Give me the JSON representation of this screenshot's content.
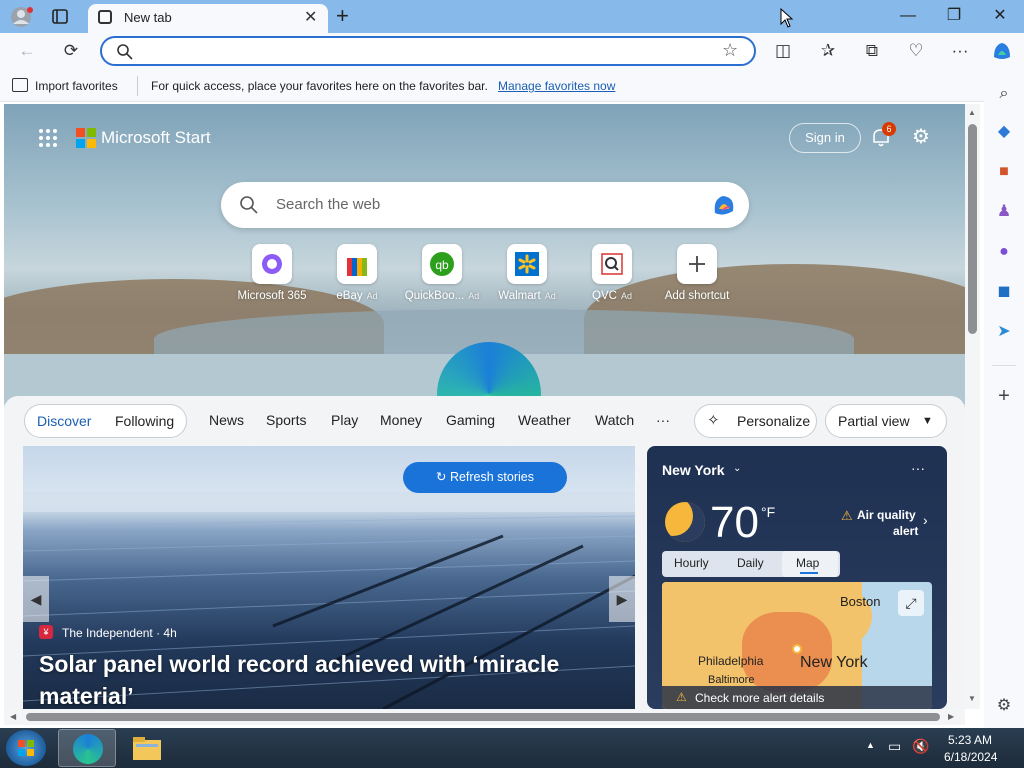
{
  "browser": {
    "tab_title": "New tab",
    "address_placeholder": "",
    "favorites_bar": {
      "import_label": "Import favorites",
      "hint": "For quick access, place your favorites here on the favorites bar.",
      "manage_link": "Manage favorites now"
    }
  },
  "header": {
    "brand": "Microsoft Start",
    "sign_in": "Sign in",
    "notification_count": "6"
  },
  "search": {
    "placeholder": "Search the web"
  },
  "shortcuts": [
    {
      "label": "Microsoft 365",
      "ad": ""
    },
    {
      "label": "eBay",
      "ad": "Ad"
    },
    {
      "label": "QuickBoo...",
      "ad": "Ad"
    },
    {
      "label": "Walmart",
      "ad": "Ad"
    },
    {
      "label": "QVC",
      "ad": "Ad"
    },
    {
      "label": "Add shortcut",
      "ad": ""
    }
  ],
  "feed_nav": {
    "discover": "Discover",
    "following": "Following",
    "tabs": [
      "News",
      "Sports",
      "Play",
      "Money",
      "Gaming",
      "Weather",
      "Watch"
    ],
    "more": "···",
    "personalize": "Personalize",
    "view_mode": "Partial view"
  },
  "story": {
    "refresh": "Refresh stories",
    "source": "The Independent · 4h",
    "headline": "Solar panel world record achieved with ‘miracle material’"
  },
  "weather": {
    "location": "New York",
    "temperature": "70",
    "unit": "°F",
    "alert_line1": "Air quality",
    "alert_line2": "alert",
    "tabs": [
      "Hourly",
      "Daily",
      "Map"
    ],
    "map_labels": [
      "Boston",
      "Philadelphia",
      "New York",
      "Baltimore"
    ],
    "more_alerts": "Check more alert details"
  },
  "taskbar": {
    "time": "5:23 AM",
    "date": "6/18/2024"
  }
}
